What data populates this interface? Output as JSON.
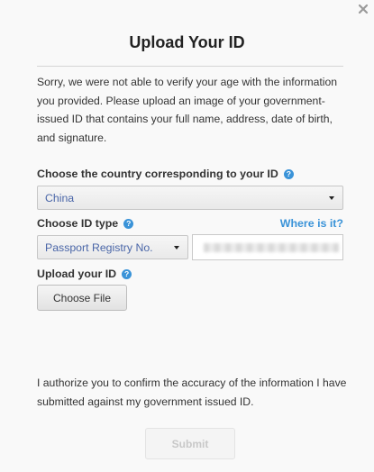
{
  "dialog": {
    "title": "Upload Your ID",
    "intro_text": "Sorry, we were not able to verify your age with the information you provided. Please upload an image of your government-issued ID that contains your full name, address, date of birth, and signature.",
    "authorization_text": "I authorize you to confirm the accuracy of the information I have submitted against my government issued ID."
  },
  "country": {
    "label": "Choose the country corresponding to your ID",
    "selected": "China"
  },
  "id_type": {
    "label": "Choose ID type",
    "where_link": "Where is it?",
    "selected": "Passport Registry No.",
    "number_value": ""
  },
  "upload": {
    "label": "Upload your ID",
    "choose_file_label": "Choose File"
  },
  "actions": {
    "submit_label": "Submit"
  },
  "icons": {
    "help": "?",
    "close": "close-icon"
  },
  "colors": {
    "accent": "#3a93d8",
    "select_text": "#4a66a8",
    "disabled_text": "#c8c8c8"
  }
}
